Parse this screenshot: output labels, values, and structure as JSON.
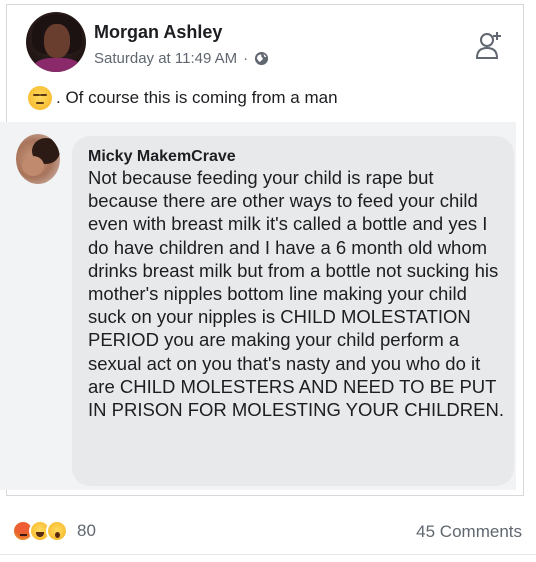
{
  "post": {
    "author": "Morgan Ashley",
    "timestamp": "Saturday at 11:49 AM",
    "separator": "·",
    "audience_icon": "globe-icon",
    "text": ". Of course this is coming from a man",
    "emoji": "unamused-face"
  },
  "comment": {
    "author": "Micky MakemCrave",
    "text": "Not because feeding your child is rape but because there are other ways to feed your child even with breast milk it's called a bottle and yes I do have children and I have a 6 month old whom drinks breast milk but from a bottle not sucking his mother's nipples bottom line making your child suck on your nipples is CHILD MOLESTATION PERIOD you are making your child perform a sexual act on you that's nasty and you who do it are CHILD MOLESTERS AND NEED TO BE PUT IN PRISON FOR MOLESTING YOUR CHILDREN."
  },
  "footer": {
    "reaction_icons": [
      "angry-reaction",
      "haha-reaction",
      "wow-reaction"
    ],
    "reaction_count": "80",
    "comments": "45 Comments"
  },
  "colors": {
    "text": "#1c1e21",
    "meta": "#606770",
    "bubble": "#e8e9eb"
  }
}
